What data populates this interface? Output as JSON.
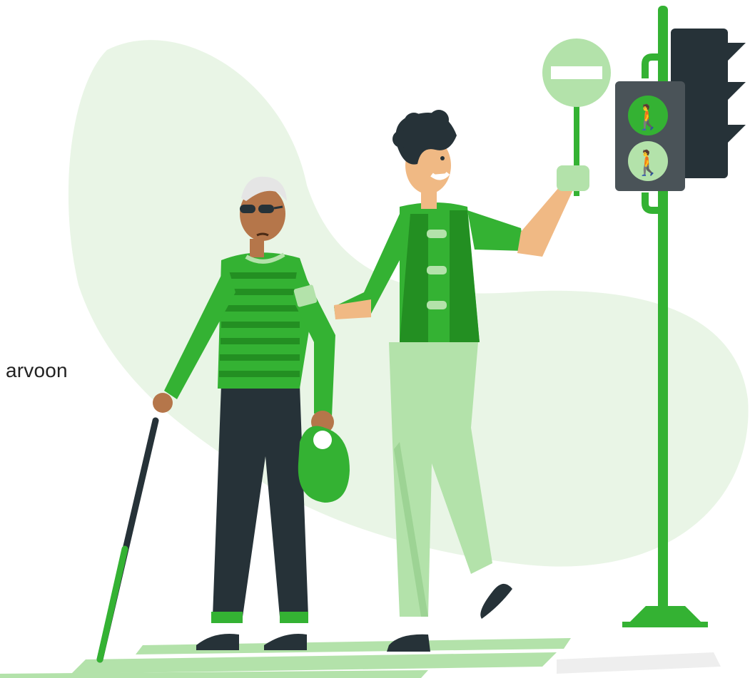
{
  "caption": {
    "text": "arvoon"
  },
  "colors": {
    "green": "#34b233",
    "dark_green": "#238f22",
    "light_green": "#b3e2aa",
    "pale_green": "#e9f5e6",
    "dark": "#263238",
    "skin": "#f0b984",
    "skin_dark": "#b5764a",
    "white": "#ffffff"
  },
  "illustration": {
    "subjects": [
      "elderly-man-with-cane",
      "helper-person",
      "traffic-light",
      "no-entry-sign",
      "crosswalk"
    ],
    "traffic_light_state": "green-pedestrian"
  }
}
